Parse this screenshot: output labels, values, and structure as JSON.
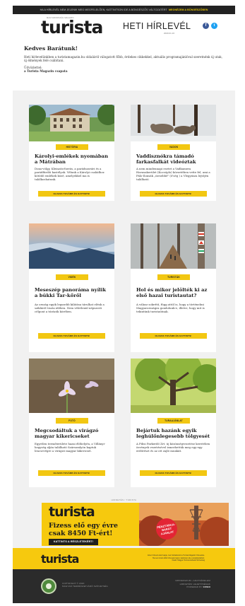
{
  "topbar": {
    "text": "HA A HÍRLEVÉL NEM JELENIK MEG MEGFELELŐEN, KATTINTSON IDE A BÖNGÉSZŐS VÁLTOZATÉRT",
    "link": "MEGNÉZEM A BÖNGÉSZŐBEN"
  },
  "header": {
    "logo_small": "MAGYARORSZÁG MAGAZIN",
    "logo": "turista",
    "title": "HETI HÍRLEVÉL",
    "date": "2020.01.16",
    "social": [
      "facebook-icon",
      "twitter-icon"
    ]
  },
  "intro": {
    "greeting": "Kedves Barátunk!",
    "body": "Heti hírlevelünkben a turistamagazin.hu oldaláról válogatott főbb, érdekes cikkekkel, aktuális programajánlóval szeretnénk új utak, új élmények felé csábítani.",
    "sign_label": "Üdvözlettel:",
    "sign_name": "a Turista Magazin csapata"
  },
  "cards": [
    {
      "tag": "HISTÓRIA",
      "title": "Károlyi-emlékek nyomában a Mátrában",
      "text": "Doxa-völgy, Kleinzón-forrás, a parádsasvári és a parádfürdői kastélyok. Vélunk a Károlyi családhoz kötődő emlékek közé, amelyekkel ma is találkozhatunk.",
      "button": "OLVASS TOVÁBB ÉS KATTINTS!"
    },
    {
      "tag": "VADON",
      "title": "Vaddisznókra támadó farkasfalkát videóztak",
      "text": "A nem mindennapi esetet a Vadkamera Havasakerület (Kocsóplo) körzetében vette fel, ami a Pálo-Ilonsák „ízesebbé\" (ő'ség ) a Vlegyásza lejtőjén található.",
      "button": "OLVASS TOVÁBB ÉS KATTINTS!"
    },
    {
      "tag": "VIDÉK",
      "title": "Meseszép panoráma nyílik a bükki Tar-kőről",
      "text": "Az ország egyik legszebb kilátása tárulhat elénk a szikláról tiszta időben. Nem véletlenül népszerű célpont a túrázók körében.",
      "button": "OLVASS TOVÁBB ÉS KATTINTS!"
    },
    {
      "tag": "TURISTÁK",
      "title": "Hol és mikor jelölték ki az első hazai turistautat?",
      "text": "A válasz sokrétű, függ attól is, hogy a történelmi Magyarországra gondolunk-e, illetve, hogy mit is tekintünk turistaútnak.",
      "button": "OLVASS TOVÁBB ÉS KATTINTS!"
    },
    {
      "tag": "FOTÓ",
      "title": "Megcsodáltuk a virágzó magyar kikericseket",
      "text": "Egyetlen termőterülete hazai élőhelyén, a Villányi-hegység alján található Szársomlyón kaptuk lencsevégre a virágzó magyar kikericset.",
      "button": "OLVASS TOVÁBB ÉS KATTINTS!"
    },
    {
      "tag": "TURAAJÁNLAT",
      "title": "Bejártuk hazánk egyik leghúlőnlegesebb tölgyesét",
      "text": "A Pilisi Parkerdő Zrt. új közönségvezetése keretében ösvények vezetésével ismerhettük meg egy-egy erdőrészt és az ott zajló munkát.",
      "button": "OLVASS TOVÁBB ÉS KATTINTS!"
    }
  ],
  "promo": {
    "label": "HIRDETÉS / TURISTA",
    "logo": "turista",
    "headline_1": "Fizess elő egy évre",
    "headline_2": "csak 8450 Ft-ért!",
    "button": "KATTINTS A RÉSZLETEKÉRT!",
    "badge_1": "PÉNZTÁRCA-",
    "badge_2": "BARÁT",
    "badge_3": "AJÁNLAT"
  },
  "footer": {
    "logo": "turista",
    "info_1": "Ezen hírlevél azért kapja, mert feliratkozott a Turista Magazin hírlevelére.",
    "info_2": "Ha nem kíván több hírlevelet kapni, kattintson ide a leiratkozáshoz.",
    "info_3": "Kiadó: Magyar Természetbarát Szövetség",
    "copy_1": "COPYRIGHT © 2020",
    "copy_2": "MAGYAR TERMÉSZETJÁRÓ SZÖVETSÉG",
    "link_1": "IMPRESSZUM • ADATVÉDELEM",
    "link_2": "HIRDETÉSI LEHETŐSÉGEK",
    "link_3": "POWERED BY",
    "link_3b": "CIVEO"
  }
}
